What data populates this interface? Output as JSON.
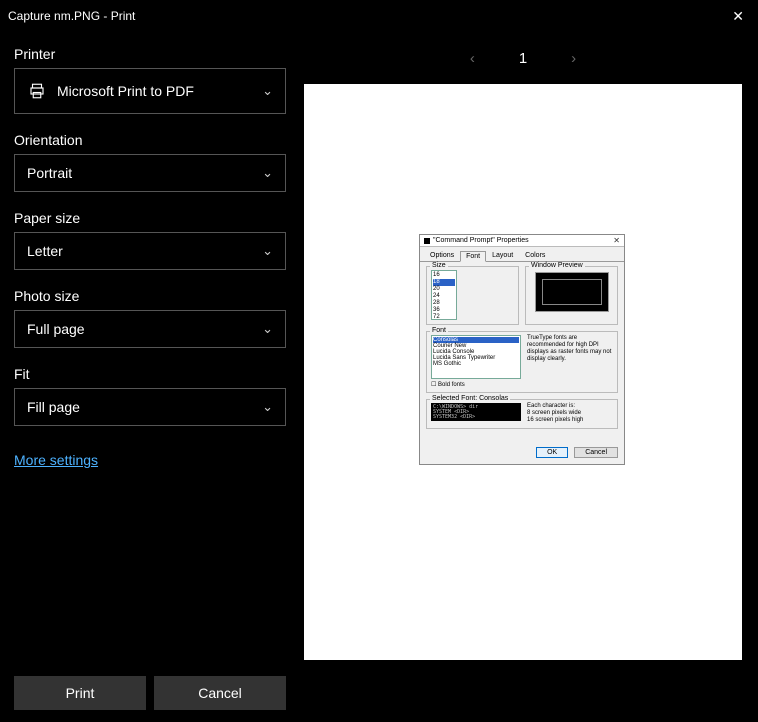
{
  "window": {
    "title": "Capture nm.PNG - Print",
    "close_glyph": "✕"
  },
  "fields": {
    "printer_label": "Printer",
    "printer_value": "Microsoft Print to PDF",
    "orientation_label": "Orientation",
    "orientation_value": "Portrait",
    "paper_size_label": "Paper size",
    "paper_size_value": "Letter",
    "photo_size_label": "Photo size",
    "photo_size_value": "Full page",
    "fit_label": "Fit",
    "fit_value": "Fill page",
    "more_settings": "More settings"
  },
  "pager": {
    "prev_glyph": "‹",
    "next_glyph": "›",
    "page_number": "1"
  },
  "buttons": {
    "print": "Print",
    "cancel": "Cancel"
  },
  "chevron": "⌄",
  "preview": {
    "dialog_title": "\"Command Prompt\" Properties",
    "close_glyph": "✕",
    "tabs": {
      "options": "Options",
      "font": "Font",
      "layout": "Layout",
      "colors": "Colors"
    },
    "size_label": "Size",
    "window_preview_label": "Window Preview",
    "font_label": "Font",
    "sizes": [
      "16",
      "18",
      "20",
      "24",
      "28",
      "36",
      "72"
    ],
    "size_selected": "18",
    "fonts": [
      "Consolas",
      "Courier New",
      "Lucida Console",
      "Lucida Sans Typewriter",
      "MS Gothic"
    ],
    "font_selected": "Consolas",
    "font_note": "TrueType fonts are recommended for high DPI displays as raster fonts may not display clearly.",
    "bold_label": "Bold fonts",
    "selected_font_label": "Selected Font: Consolas",
    "sample_line1": "C:\\WINDOWS> dir",
    "sample_line2": "SYSTEM       <DIR>",
    "sample_line3": "SYSTEM32     <DIR>",
    "char_desc_label": "Each character is:",
    "char_desc_line1": "8 screen pixels wide",
    "char_desc_line2": "16 screen pixels high",
    "ok": "OK",
    "cancel": "Cancel"
  }
}
